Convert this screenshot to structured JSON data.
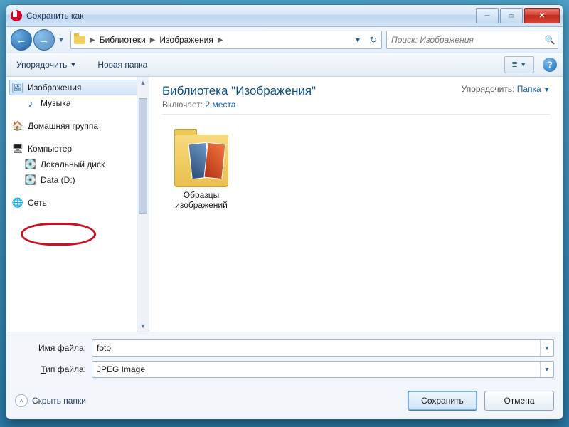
{
  "title": "Сохранить как",
  "nav": {
    "breadcrumb": [
      "Библиотеки",
      "Изображения"
    ],
    "search_placeholder": "Поиск: Изображения"
  },
  "toolbar": {
    "organize": "Упорядочить",
    "new_folder": "Новая папка"
  },
  "sidebar": {
    "items": [
      {
        "label": "Изображения",
        "icon": "ic-lib",
        "selected": true,
        "indent": 1
      },
      {
        "label": "Музыка",
        "icon": "ic-music",
        "selected": false,
        "indent": 1
      },
      {
        "gap": true
      },
      {
        "label": "Домашняя группа",
        "icon": "ic-home",
        "selected": false,
        "indent": 0
      },
      {
        "gap": true
      },
      {
        "label": "Компьютер",
        "icon": "ic-pc",
        "selected": false,
        "indent": 0
      },
      {
        "label": "Локальный диск",
        "icon": "ic-drive",
        "selected": false,
        "indent": 1
      },
      {
        "label": "Data (D:)",
        "icon": "ic-drive2",
        "selected": false,
        "indent": 1,
        "circled": true
      },
      {
        "gap": true
      },
      {
        "label": "Сеть",
        "icon": "ic-net",
        "selected": false,
        "indent": 0
      }
    ]
  },
  "content": {
    "library_title": "Библиотека \"Изображения\"",
    "includes_label": "Включает:",
    "includes_link": "2 места",
    "sort_label": "Упорядочить:",
    "sort_value": "Папка",
    "items": [
      {
        "caption_line1": "Образцы",
        "caption_line2": "изображений"
      }
    ]
  },
  "fields": {
    "filename_label_pre": "И",
    "filename_label_u": "м",
    "filename_label_post": "я файла:",
    "filename_value": "foto",
    "filetype_label_u": "Т",
    "filetype_label_post": "ип файла:",
    "filetype_value": "JPEG Image"
  },
  "actions": {
    "hide_folders": "Скрыть папки",
    "save": "Сохранить",
    "cancel": "Отмена"
  }
}
